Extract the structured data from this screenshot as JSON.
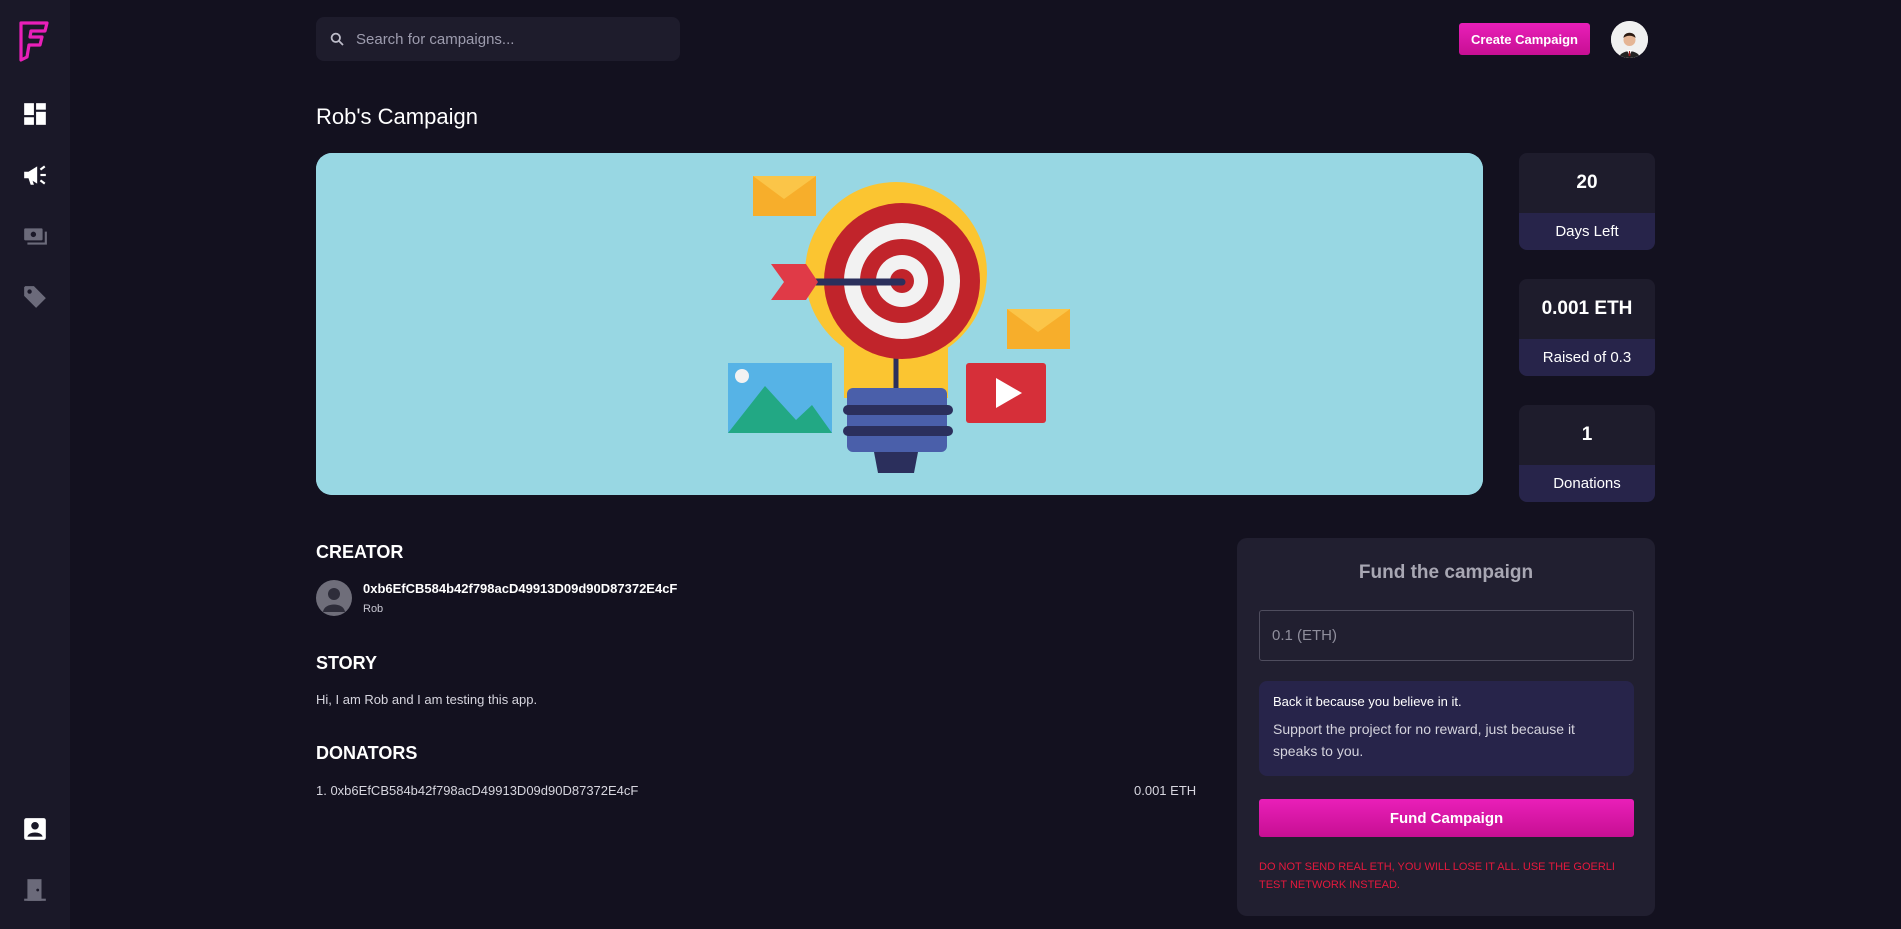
{
  "sidebar": {
    "items": [
      {
        "icon": "dashboard-icon"
      },
      {
        "icon": "megaphone-icon"
      },
      {
        "icon": "payment-icon"
      },
      {
        "icon": "tag-icon"
      },
      {
        "icon": "profile-icon"
      },
      {
        "icon": "logout-icon"
      }
    ]
  },
  "header": {
    "search_placeholder": "Search for campaigns...",
    "create_button": "Create Campaign"
  },
  "campaign": {
    "title": "Rob's Campaign",
    "stats": [
      {
        "value": "20",
        "label": "Days Left"
      },
      {
        "value": "0.001 ETH",
        "label": "Raised of 0.3"
      },
      {
        "value": "1",
        "label": "Donations"
      }
    ]
  },
  "creator": {
    "heading": "CREATOR",
    "address": "0xb6EfCB584b42f798acD49913D09d90D87372E4cF",
    "name": "Rob"
  },
  "story": {
    "heading": "STORY",
    "text": "Hi, I am Rob and I am testing this app."
  },
  "donators": {
    "heading": "DONATORS",
    "items": [
      {
        "address": "1. 0xb6EfCB584b42f798acD49913D09d90D87372E4cF",
        "amount": "0.001 ETH"
      }
    ]
  },
  "fund": {
    "title": "Fund the campaign",
    "input_placeholder": "0.1 (ETH)",
    "info_heading": "Back it because you believe in it.",
    "info_body": "Support the project for no reward, just because it speaks to you.",
    "button": "Fund Campaign",
    "warning": "DO NOT SEND REAL ETH, YOU WILL LOSE IT ALL. USE THE GOERLI TEST NETWORK INSTEAD."
  },
  "colors": {
    "accent": "#e91fb9",
    "background": "#13111f",
    "warning": "#e5193d"
  }
}
